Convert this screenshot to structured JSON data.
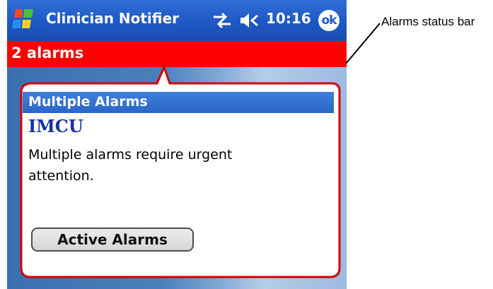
{
  "titlebar": {
    "start_icon": "windows-flag-icon",
    "app_title": "Clinician Notifier",
    "connectivity_icon": "connectivity-icon",
    "volume_icon": "speaker-icon",
    "time": "10:16",
    "ok_label": "ok"
  },
  "status_bar": {
    "text": "2 alarms",
    "color": "#ff0000"
  },
  "notification": {
    "title": "Multiple Alarms",
    "unit": "IMCU",
    "message": "Multiple alarms require urgent attention.",
    "button_label": "Active Alarms"
  },
  "callout": {
    "label": "Alarms status bar"
  },
  "colors": {
    "title_bar": "#1f57c4",
    "bubble_border": "#d40000",
    "unit_text": "#1432a8"
  }
}
